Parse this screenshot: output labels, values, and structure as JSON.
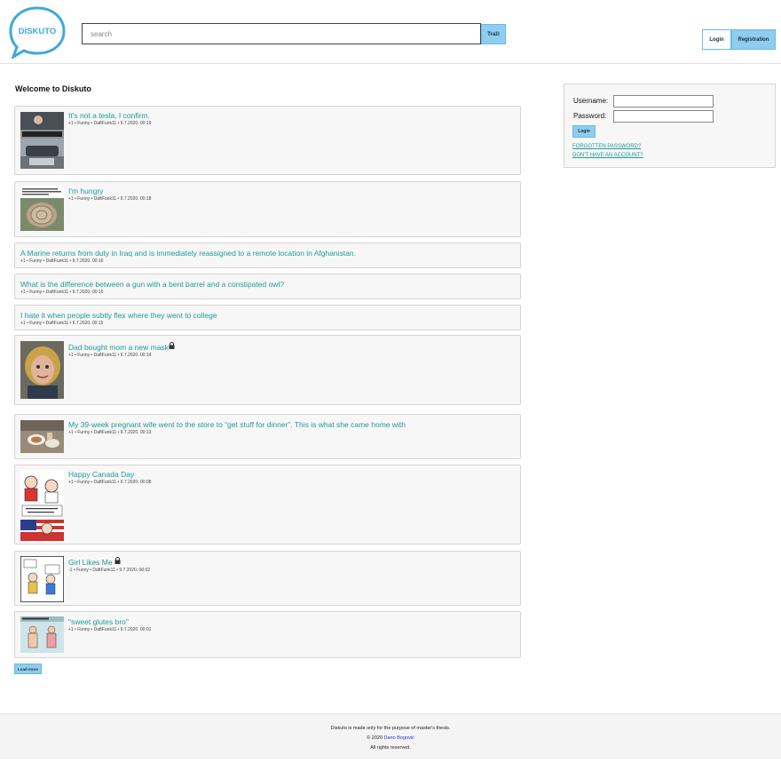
{
  "header": {
    "logo_text": "DISKUTO",
    "search_placeholder": "search",
    "search_button": "Traži",
    "login_button": "Login",
    "registration_button": "Registration"
  },
  "main": {
    "welcome": "Welcome to Diskuto",
    "posts": [
      {
        "title": "It's not a tesla, I confirm.",
        "meta": "+1 • Funny • DaftFunk11 • 9.7.2020. 00:19",
        "thumb": "car-screenshot",
        "locked": false
      },
      {
        "title": "I'm hungry",
        "meta": "+1 • Funny • DaftFunk11 • 9.7.2020. 00:18",
        "thumb": "tree-stump-pie",
        "locked": false
      },
      {
        "title": "A Marine returns from duty in Iraq and is immediately reassigned to a remote location in Afghanistan.",
        "meta": "+1 • Funny • DaftFunk11 • 9.7.2020. 00:16",
        "locked": false
      },
      {
        "title": "What is the difference between a gun with a bent barrel and a constipated owl?",
        "meta": "+1 • Funny • DaftFunk11 • 9.7.2020. 00:15",
        "locked": false
      },
      {
        "title": "I hate it when people subtly flex where they went to college",
        "meta": "+1 • Funny • DaftFunk11 • 9.7.2020. 00:15",
        "locked": false
      },
      {
        "title": "Dad bought mom a new mask",
        "meta": "+1 • Funny • DaftFunk11 • 9.7.2020. 00:14",
        "thumb": "woman-portrait",
        "locked": true
      },
      {
        "title": "My 39-week pregnant wife went to the store to “get stuff for dinner”. This is what she came home with",
        "meta": "+1 • Funny • DaftFunk11 • 9.7.2020. 00:13",
        "thumb": "dinner-table",
        "locked": false
      },
      {
        "title": "Happy Canada Day",
        "meta": "+1 • Funny • DaftFunk11 • 9.7.2020. 00:08",
        "thumb": "comic-canada",
        "locked": false
      },
      {
        "title": "Girl Likes Me",
        "meta": "-1 • Funny • DaftFunk11 • 9.7.2020. 00:02",
        "thumb": "comic-girl",
        "locked": true
      },
      {
        "title": "\"sweet glutes bro\"",
        "meta": "+1 • Funny • DaftFunk11 • 9.7.2020. 00:01",
        "thumb": "comic-glutes",
        "locked": false
      }
    ],
    "load_more": "Load more"
  },
  "login_box": {
    "username_label": "Username:",
    "password_label": "Password:",
    "login_button": "Login",
    "forgotten_password": "FORGOTTEN PASSWORD?",
    "no_account": "DON'T HAVE AN ACCOUNT?"
  },
  "footer": {
    "line1": "Diskuto is made only for the purpose of master's thesis.",
    "copyright": "© 2020",
    "author": "Dario Bogović",
    "line3": "All rights reserved."
  },
  "colors": {
    "accent": "#8ecdf0",
    "link": "#1f9a9a",
    "logo": "#3fa9d6"
  }
}
